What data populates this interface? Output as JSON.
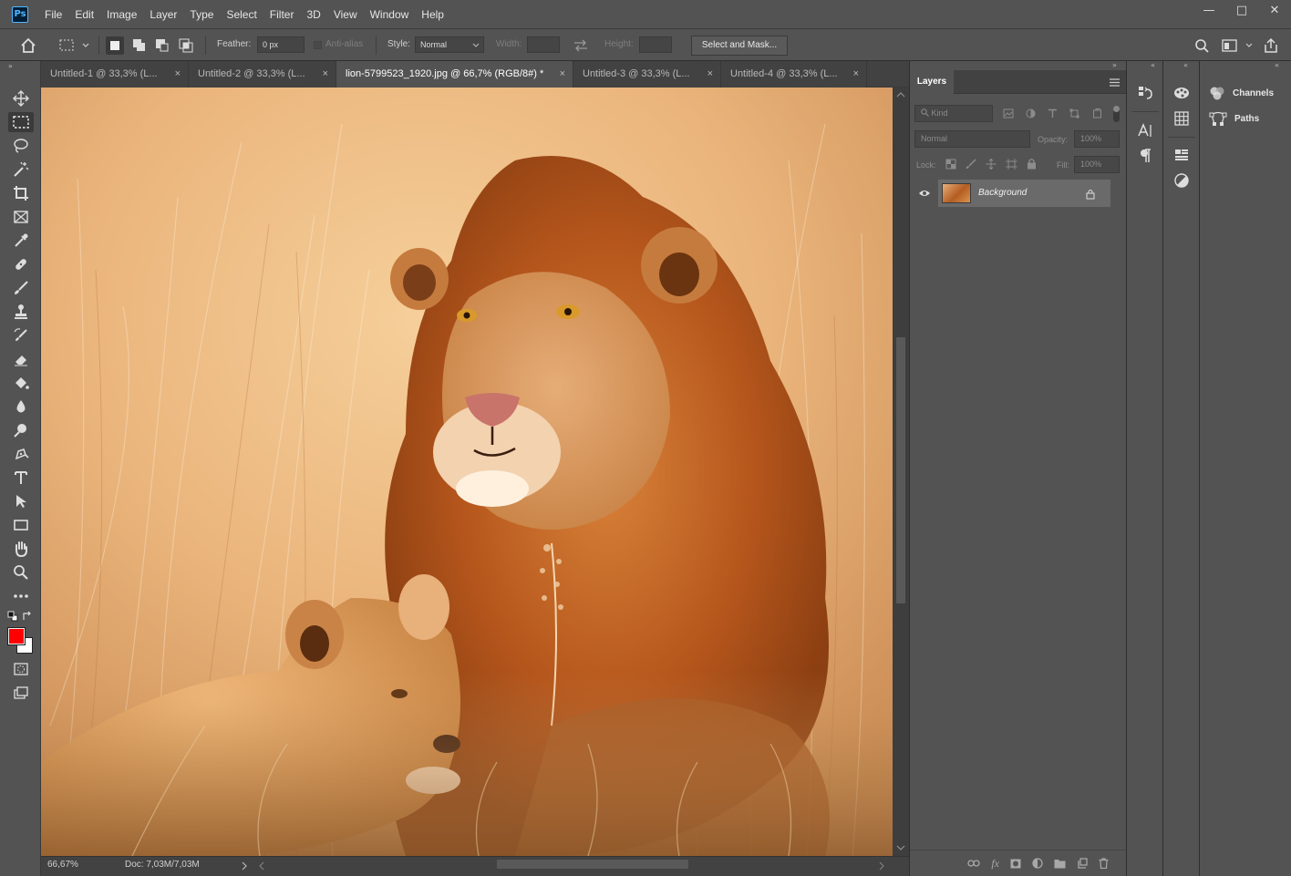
{
  "app": {
    "logo": "Ps"
  },
  "menu": [
    "File",
    "Edit",
    "Image",
    "Layer",
    "Type",
    "Select",
    "Filter",
    "3D",
    "View",
    "Window",
    "Help"
  ],
  "window_controls": [
    "—",
    "□",
    "✕"
  ],
  "options": {
    "feather_label": "Feather:",
    "feather_value": "0 px",
    "antialias_label": "Anti-alias",
    "style_label": "Style:",
    "style_value": "Normal",
    "width_label": "Width:",
    "height_label": "Height:",
    "select_mask": "Select and Mask..."
  },
  "tabs": [
    {
      "label": "Untitled-1 @ 33,3% (L...",
      "active": false
    },
    {
      "label": "Untitled-2 @ 33,3% (L...",
      "active": false
    },
    {
      "label": "lion-5799523_1920.jpg @ 66,7% (RGB/8#) *",
      "active": true
    },
    {
      "label": "Untitled-3 @ 33,3% (L...",
      "active": false
    },
    {
      "label": "Untitled-4 @ 33,3% (L...",
      "active": false
    }
  ],
  "tab_close": "×",
  "status": {
    "zoom": "66,67%",
    "doc": "Doc: 7,03M/7,03M"
  },
  "colors": {
    "foreground": "#ff0000",
    "background": "#ffffff",
    "accent": "#4fb7ff"
  },
  "layers": {
    "title": "Layers",
    "filter_kind": "Kind",
    "blend_mode": "Normal",
    "opacity_label": "Opacity:",
    "opacity_value": "100%",
    "lock_label": "Lock:",
    "fill_label": "Fill:",
    "fill_value": "100%",
    "items": [
      {
        "name": "Background",
        "visible": true,
        "locked": true
      }
    ],
    "bottom_icons": [
      "link-icon",
      "fx-icon",
      "mask-icon",
      "adjustment-icon",
      "folder-icon",
      "new-layer-icon",
      "trash-icon"
    ]
  },
  "right_panels": {
    "channels": "Channels",
    "paths": "Paths"
  }
}
